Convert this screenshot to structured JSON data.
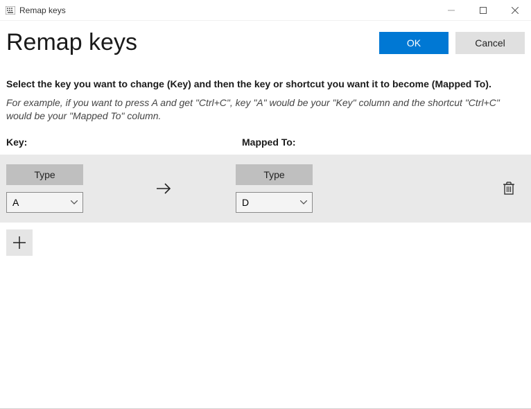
{
  "window": {
    "title": "Remap keys"
  },
  "header": {
    "pageTitle": "Remap keys",
    "okLabel": "OK",
    "cancelLabel": "Cancel"
  },
  "instructions": {
    "bold": "Select the key you want to change (Key) and then the key or shortcut you want it to become (Mapped To).",
    "italic": "For example, if you want to press A and get \"Ctrl+C\", key \"A\" would be your \"Key\" column and the shortcut \"Ctrl+C\" would be your \"Mapped To\" column."
  },
  "columns": {
    "key": "Key:",
    "mapped": "Mapped To:"
  },
  "row": {
    "typeLabel": "Type",
    "keyValue": "A",
    "mappedValue": "D"
  }
}
